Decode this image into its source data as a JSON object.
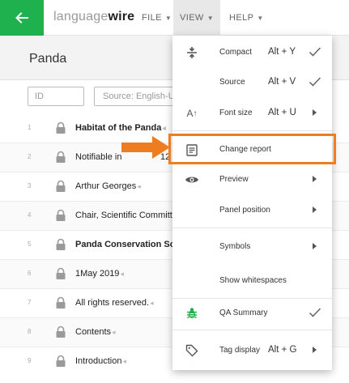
{
  "header": {
    "logo_light": "language",
    "logo_bold": "wire",
    "menus": [
      {
        "label": "FILE"
      },
      {
        "label": "VIEW"
      },
      {
        "label": "HELP"
      }
    ]
  },
  "panel": {
    "title": "Panda"
  },
  "filter": {
    "id_placeholder": "ID",
    "source_placeholder": "Source: English-Un"
  },
  "rows": [
    {
      "num": "1",
      "text": "Habitat of the Panda"
    },
    {
      "num": "2",
      "text": "Notifiable in"
    },
    {
      "num": "3",
      "text": "Arthur Georges"
    },
    {
      "num": "4",
      "text": "Chair, Scientific Committe"
    },
    {
      "num": "5",
      "text": "Panda Conservation Sche"
    },
    {
      "num": "6",
      "text": "1May 2019"
    },
    {
      "num": "7",
      "text": "All rights reserved."
    },
    {
      "num": "8",
      "text": "Contents"
    },
    {
      "num": "9",
      "text": "Introduction"
    }
  ],
  "row2_extra": "12",
  "view_menu": {
    "items": [
      {
        "label": "Compact",
        "shortcut": "Alt + Y"
      },
      {
        "label": "Source",
        "shortcut": "Alt + V"
      },
      {
        "label": "Font size",
        "shortcut": "Alt + U"
      },
      {
        "label": "Change report"
      },
      {
        "label": "Preview"
      },
      {
        "label": "Panel position"
      },
      {
        "label": "Symbols"
      },
      {
        "label": "Show whitespaces"
      },
      {
        "label": "QA Summary"
      },
      {
        "label": "Tag display",
        "shortcut": "Alt + G"
      }
    ]
  },
  "colors": {
    "accent_green": "#1eb14e",
    "highlight_orange": "#ee7d22"
  }
}
